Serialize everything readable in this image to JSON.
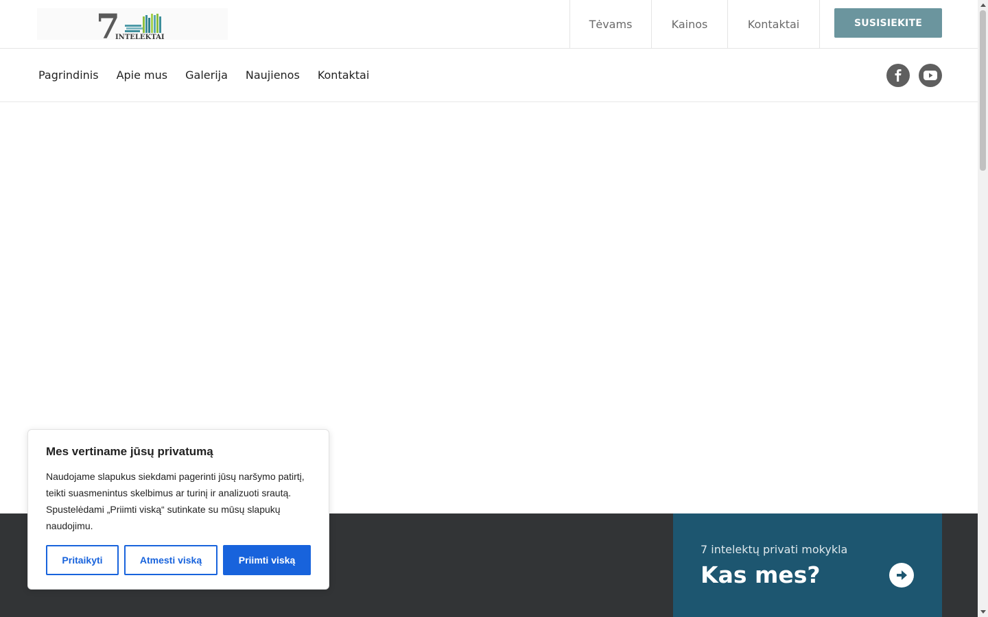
{
  "header": {
    "logo_text": "INTELEKTAI",
    "logo_number": "7",
    "top_links": [
      "Tėvams",
      "Kainos",
      "Kontaktai"
    ],
    "cta_label": "SUSISIEKITE"
  },
  "nav": {
    "items": [
      "Pagrindinis",
      "Apie mus",
      "Galerija",
      "Naujienos",
      "Kontaktai"
    ]
  },
  "social": {
    "icons": [
      "facebook-icon",
      "youtube-icon"
    ]
  },
  "promo": {
    "subtitle": "7 intelektų privati mokykla",
    "title": "Kas mes?"
  },
  "cookie": {
    "title": "Mes vertiname jūsų privatumą",
    "text": "Naudojame slapukus siekdami pagerinti jūsų naršymo patirtį, teikti suasmenintus skelbimus ar turinį ir analizuoti srautą. Spustelėdami „Priimti viską“ sutinkate su mūsų slapukų naudojimu.",
    "customize_label": "Pritaikyti",
    "reject_label": "Atmesti viską",
    "accept_label": "Priimti viską"
  },
  "colors": {
    "cta": "#6b959e",
    "promo": "#1d5670",
    "dark_band": "#323436",
    "cookie_accent": "#1863dc"
  }
}
